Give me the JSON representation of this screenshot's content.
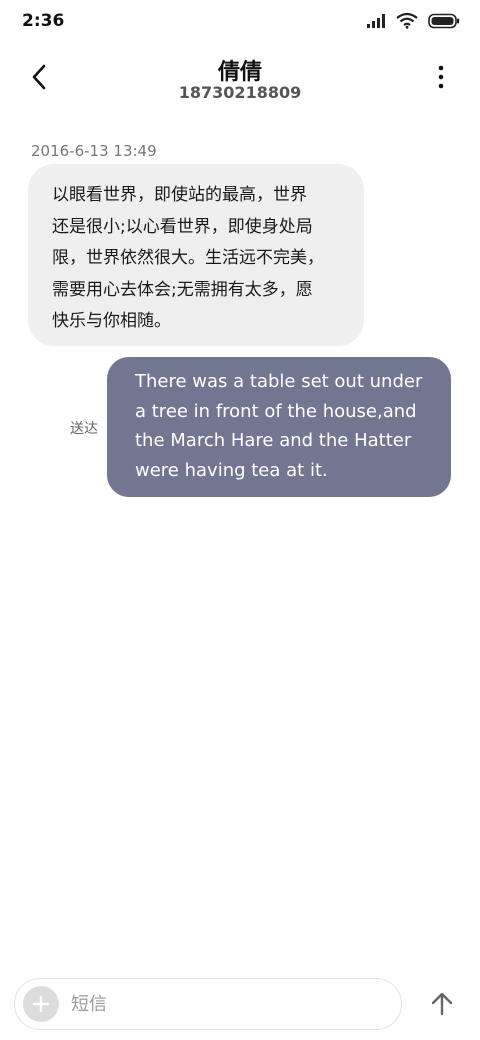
{
  "status_bar": {
    "time": "2:36",
    "icons": [
      "signal-icon",
      "wifi-icon",
      "battery-icon"
    ]
  },
  "header": {
    "contact_name": "倩倩",
    "phone_number": "18730218809",
    "back_icon": "chevron-left-icon",
    "menu_icon": "more-vertical-icon"
  },
  "conversation": {
    "timestamp": "2016-6-13 13:49",
    "incoming": {
      "lines": [
        "以眼看世界，即使站的最高，世界",
        "还是很小;以心看世界，即使身处局",
        "限，世界依然很大。生活远不完美，",
        "需要用心去体会;无需拥有太多，愿",
        "快乐与你相随。"
      ]
    },
    "outgoing": {
      "status": "送达",
      "lines": [
        "There was a table set out under",
        "a tree in front of the house,and",
        "the March Hare and the Hatter",
        "were having tea at it."
      ]
    }
  },
  "composer": {
    "placeholder": "短信",
    "attach_icon": "plus-icon",
    "send_icon": "arrow-up-icon"
  },
  "colors": {
    "incoming_bubble": "#efefef",
    "outgoing_bubble": "#737691",
    "outgoing_text": "#ffffff"
  }
}
